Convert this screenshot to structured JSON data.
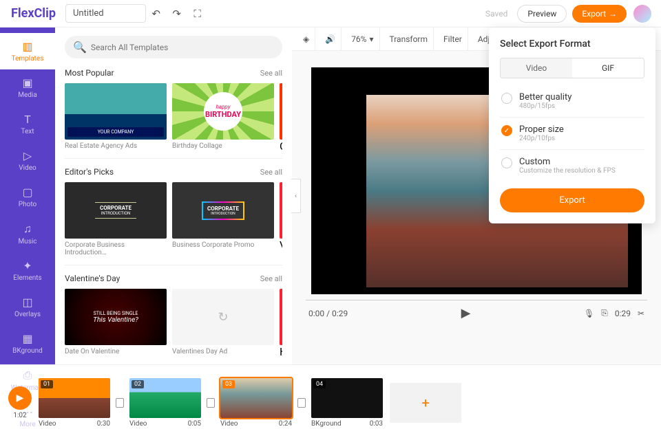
{
  "app": {
    "logo_a": "Flex",
    "logo_b": "Clip",
    "title": "Untitled",
    "saved": "Saved",
    "preview": "Preview",
    "export": "Export"
  },
  "sidebar": {
    "items": [
      {
        "label": "Templates",
        "ico": "▥"
      },
      {
        "label": "Media",
        "ico": "▣"
      },
      {
        "label": "Text",
        "ico": "T"
      },
      {
        "label": "Video",
        "ico": "▷"
      },
      {
        "label": "Photo",
        "ico": "▢"
      },
      {
        "label": "Music",
        "ico": "♫"
      },
      {
        "label": "Elements",
        "ico": "✦"
      },
      {
        "label": "Overlays",
        "ico": "◫"
      },
      {
        "label": "BKground",
        "ico": "▦"
      },
      {
        "label": "Watermark",
        "ico": "⎙"
      },
      {
        "label": "More",
        "ico": "⋯"
      }
    ]
  },
  "search": {
    "placeholder": "Search All Templates"
  },
  "sections": [
    {
      "title": "Most Popular",
      "seeall": "See all",
      "cards": [
        {
          "cap": "Real Estate Agency Ads",
          "cls": "th-realty",
          "txt": "YOUR COMPANY"
        },
        {
          "cap": "Birthday Collage",
          "cls": "th-bday",
          "txt1": "happy",
          "txt2": "BIRTHDAY"
        },
        {
          "cap": "Onl",
          "peek": "#f30"
        }
      ]
    },
    {
      "title": "Editor's Picks",
      "seeall": "See all",
      "cards": [
        {
          "cap": "Corporate Business Introduction…",
          "cls": "th-corp1",
          "txt1": "CORPORATE",
          "txt2": "INTRODUCTION"
        },
        {
          "cap": "Business Corporate Promo",
          "cls": "th-corp2",
          "txt1": "CORPORATE",
          "txt2": "INTRODUCTION"
        },
        {
          "cap": "Val",
          "peek": "#f23"
        }
      ]
    },
    {
      "title": "Valentine's Day",
      "seeall": "See all",
      "cards": [
        {
          "cap": "Date On Valentine",
          "cls": "th-val",
          "txt1": "STILL BEING SINGLE",
          "txt2": "This Valentine?"
        },
        {
          "cap": "Valentines Day Ad",
          "cls": "th-blank",
          "txt": "↻"
        },
        {
          "cap": "Hap",
          "peek": "#f23"
        }
      ]
    }
  ],
  "toolbar": {
    "zoom": "76%",
    "transform": "Transform",
    "filter": "Filter",
    "adjust": "Adjust"
  },
  "player": {
    "time": "0:00 / 0:29",
    "dur": "0:29"
  },
  "timeline": {
    "total": "1:02",
    "clips": [
      {
        "num": "01",
        "type": "Video",
        "dur": "0:30",
        "cls": "th-c1"
      },
      {
        "num": "02",
        "type": "Video",
        "dur": "0:05",
        "cls": "th-c2"
      },
      {
        "num": "03",
        "type": "Video",
        "dur": "0:24",
        "cls": "th-c3",
        "sel": true
      },
      {
        "num": "04",
        "type": "BKground",
        "dur": "0:03",
        "cls": "th-c4"
      }
    ]
  },
  "exportPanel": {
    "title": "Select Export Format",
    "tabs": [
      "Video",
      "GIF"
    ],
    "active_tab": 1,
    "options": [
      {
        "t": "Better quality",
        "s": "480p/15fps",
        "on": false
      },
      {
        "t": "Proper size",
        "s": "240p/10fps",
        "on": true
      },
      {
        "t": "Custom",
        "s": "Customize the resolution & FPS",
        "on": false
      }
    ],
    "button": "Export"
  }
}
